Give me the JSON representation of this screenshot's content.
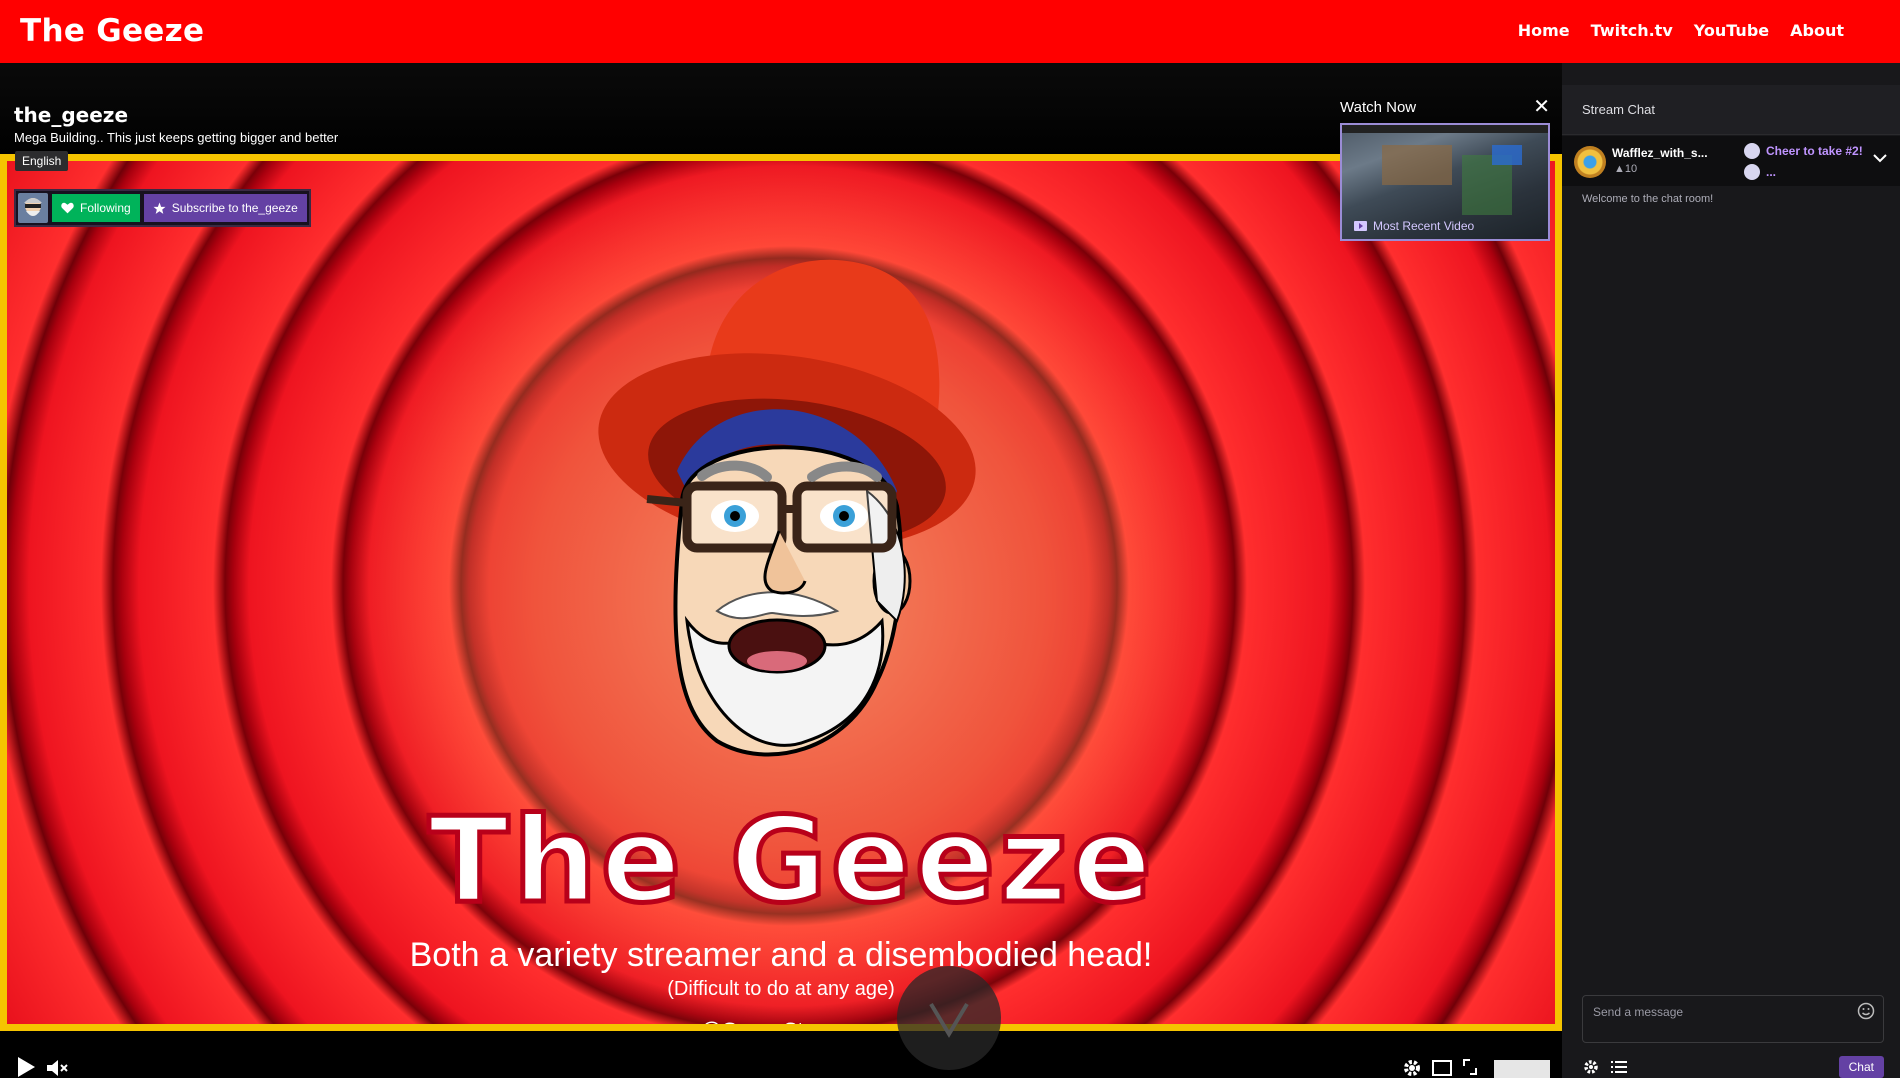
{
  "site": {
    "brand": "The Geeze"
  },
  "nav": [
    {
      "label": "Home"
    },
    {
      "label": "Twitch.tv"
    },
    {
      "label": "YouTube"
    },
    {
      "label": "About"
    }
  ],
  "stream": {
    "channel": "the_geeze",
    "title": "Mega Building.. This just keeps getting bigger and better",
    "language": "English",
    "following_label": "Following",
    "subscribe_label": "Subscribe to the_geeze"
  },
  "watch_now": {
    "label": "Watch Now",
    "close": "✕",
    "thumb_caption": "Most Recent Video"
  },
  "banner": {
    "title": "The Geeze",
    "tagline": "Both a variety streamer and a disembodied head!",
    "subtagline": "(Difficult to do at any age)",
    "handle": "@GeezeStreams"
  },
  "chat": {
    "header": "Stream Chat",
    "pinned": {
      "user": "Wafflez_with_s...",
      "bits": "10",
      "options": [
        "Cheer to take #2!",
        "..."
      ]
    },
    "welcome": "Welcome to the chat room!",
    "input_placeholder": "Send a message",
    "send_label": "Chat"
  },
  "colors": {
    "nav_bg": "#ff0000",
    "frame_border": "#f5c400",
    "follow_green": "#00b35a",
    "subscribe_purple": "#6441a4",
    "chat_bg": "#18181b"
  }
}
